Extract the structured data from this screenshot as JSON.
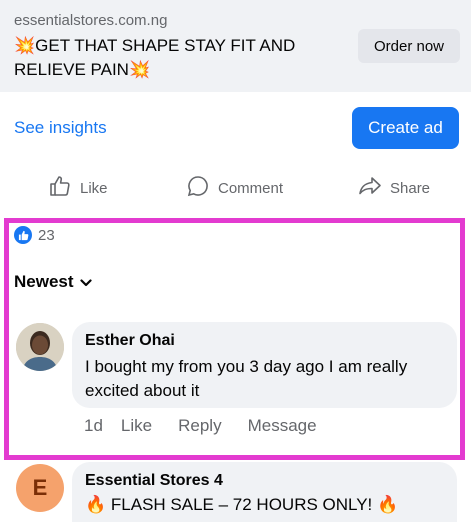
{
  "ad": {
    "domain": "essentialstores.com.ng",
    "headline": "💥GET THAT SHAPE STAY FIT AND RELIEVE PAIN💥",
    "cta_label": "Order now"
  },
  "insights": {
    "see_insights_label": "See insights",
    "create_ad_label": "Create ad"
  },
  "actions": {
    "like_label": "Like",
    "comment_label": "Comment",
    "share_label": "Share"
  },
  "reactions": {
    "count": "23"
  },
  "sort": {
    "label": "Newest"
  },
  "comments": [
    {
      "author": "Esther Ohai",
      "text": "I bought my from you 3 day ago  I am really excited about it",
      "time": "1d",
      "like_label": "Like",
      "reply_label": "Reply",
      "message_label": "Message"
    },
    {
      "author": "Essential Stores 4",
      "avatar_initial": "E",
      "text": "🔥 FLASH SALE – 72 HOURS ONLY! 🔥"
    }
  ],
  "colors": {
    "accent": "#1877f2",
    "highlight": "#e33bd0",
    "muted": "#65676b",
    "bubble": "#f0f2f5"
  }
}
